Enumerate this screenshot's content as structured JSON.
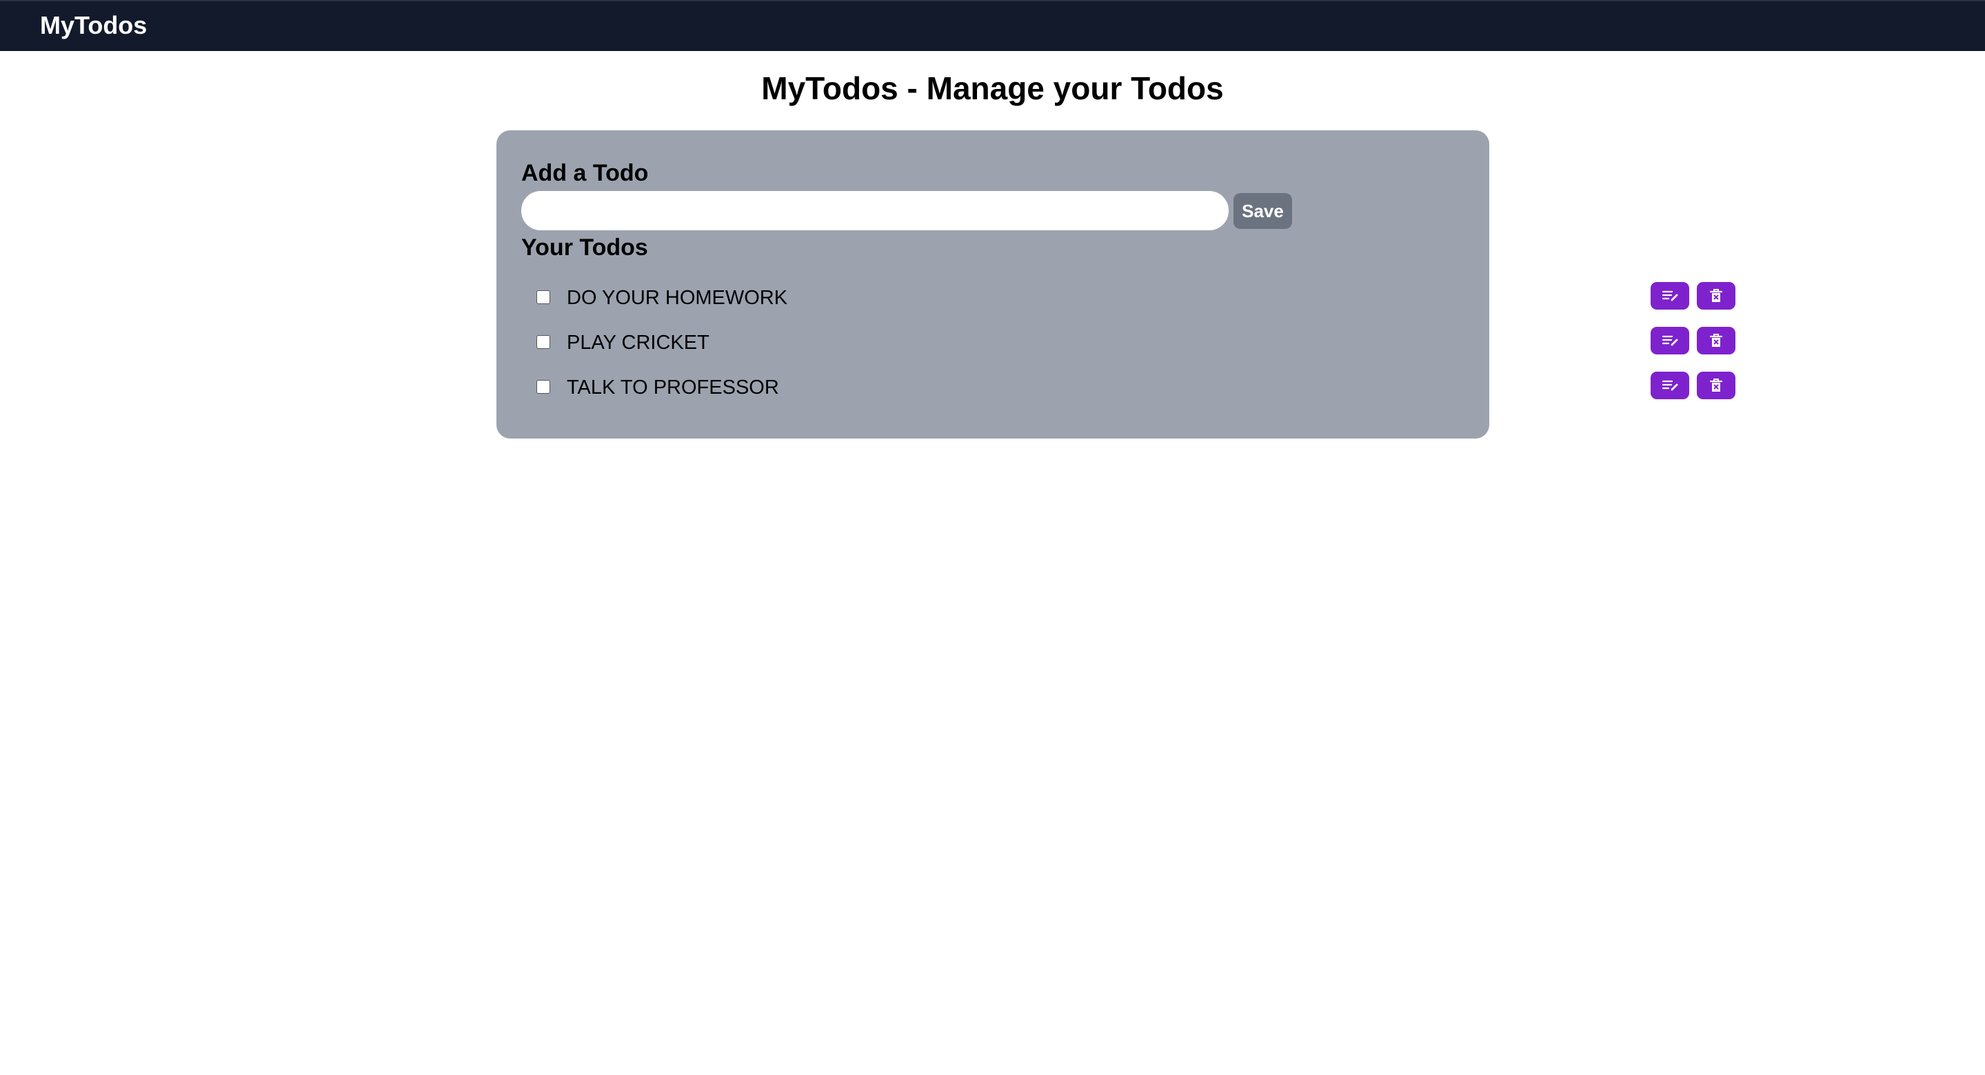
{
  "navbar": {
    "brand": "MyTodos",
    "background": "#131a2b"
  },
  "page": {
    "title": "MyTodos - Manage your Todos"
  },
  "add_todo": {
    "label": "Add a Todo",
    "input_value": "",
    "save_label": "Save"
  },
  "todo_list": {
    "label": "Your Todos",
    "items": [
      {
        "text": "DO YOUR HOMEWORK",
        "completed": false
      },
      {
        "text": "PLAY CRICKET",
        "completed": false
      },
      {
        "text": "TALK TO PROFESSOR",
        "completed": false
      }
    ]
  },
  "icons": {
    "edit": "edit-icon",
    "delete": "trash-icon"
  },
  "colors": {
    "panel": "#9ca3af",
    "action_button": "#7e22ce",
    "save_button": "#6b7280"
  }
}
